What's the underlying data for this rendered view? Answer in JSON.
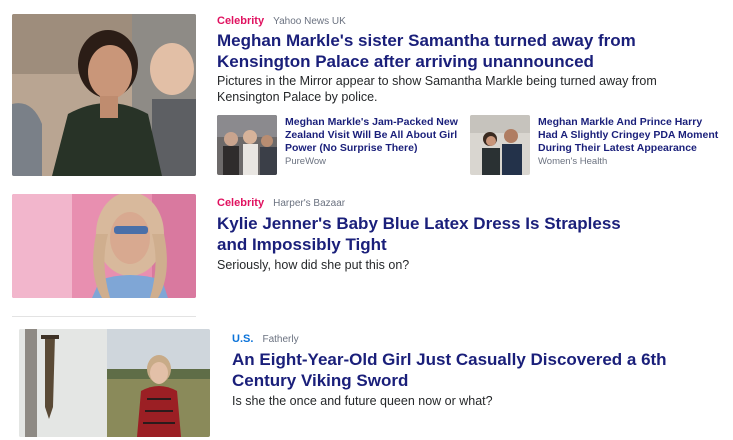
{
  "colors": {
    "headline": "#1a1f7a",
    "category_celebrity": "#e0115f",
    "category_us": "#0b73d9",
    "source": "#6b7280"
  },
  "stories": [
    {
      "category": "Celebrity",
      "source": "Yahoo News UK",
      "headline": "Meghan Markle's sister Samantha turned away from Kensington Palace after arriving unannounced",
      "summary": "Pictures in the Mirror appear to show Samantha Markle being turned away from Kensington Palace by police.",
      "image_icon": "portrait-photo",
      "related": [
        {
          "headline": "Meghan Markle's Jam-Packed New Zealand Visit Will Be All About Girl Power (No Surprise There)",
          "source": "PureWow",
          "image_icon": "crowd-photo"
        },
        {
          "headline": "Meghan Markle And Prince Harry Had A Slightly Cringey PDA Moment During Their Latest Appearance",
          "source": "Women's Health",
          "image_icon": "couple-photo"
        }
      ]
    },
    {
      "category": "Celebrity",
      "source": "Harper's Bazaar",
      "headline": "Kylie Jenner's Baby Blue Latex Dress Is Strapless and Impossibly Tight",
      "summary": "Seriously, how did she put this on?",
      "image_icon": "pink-portrait-photo"
    },
    {
      "category": "U.S.",
      "source": "Fatherly",
      "headline": "An Eight-Year-Old Girl Just Casually Discovered a 6th Century Viking Sword",
      "summary": "Is she the once and future queen now or what?",
      "image_icon": "sword-photo"
    }
  ]
}
